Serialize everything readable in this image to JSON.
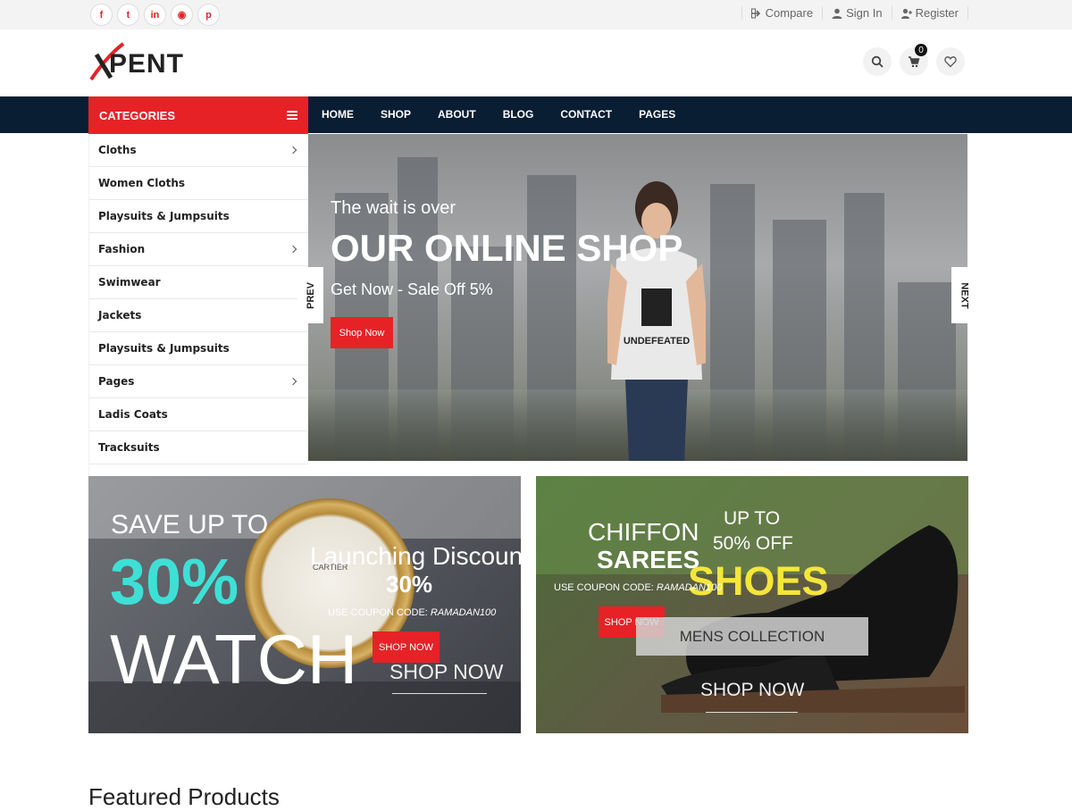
{
  "topbar": {
    "social": [
      {
        "icon": "facebook-icon",
        "glyph": "f"
      },
      {
        "icon": "twitter-icon",
        "glyph": "t"
      },
      {
        "icon": "linkedin-icon",
        "glyph": "in"
      },
      {
        "icon": "rss-icon",
        "glyph": "◉"
      },
      {
        "icon": "pinterest-icon",
        "glyph": "p"
      }
    ],
    "compare": "Compare",
    "sign_in": "Sign In",
    "register": "Register"
  },
  "header": {
    "logo_text": "PENT",
    "cart_count": "0"
  },
  "nav": {
    "categories_label": "CATEGORIES",
    "menu": [
      "HOME",
      "SHOP",
      "ABOUT",
      "BLOG",
      "CONTACT",
      "PAGES"
    ]
  },
  "categories": [
    {
      "label": "Cloths",
      "sub": true
    },
    {
      "label": "Women Cloths",
      "sub": false
    },
    {
      "label": "Playsuits & Jumpsuits",
      "sub": false
    },
    {
      "label": "Fashion",
      "sub": true
    },
    {
      "label": "Swimwear",
      "sub": false
    },
    {
      "label": "Jackets",
      "sub": false
    },
    {
      "label": "Playsuits & Jumpsuits",
      "sub": false
    },
    {
      "label": "Pages",
      "sub": true
    },
    {
      "label": "Ladis Coats",
      "sub": false
    },
    {
      "label": "Tracksuits",
      "sub": false
    }
  ],
  "hero": {
    "line1": "The wait is over",
    "line2": "OUR ONLINE SHOP",
    "line3": "Get Now - Sale Off 5%",
    "button": "Shop Now",
    "prev": "PREV",
    "next": "NEXT",
    "tshirt_text": "UNDEFEATED"
  },
  "banner_watch": {
    "save": "SAVE UP TO",
    "percent": "30%",
    "watch": "WATCH",
    "launch": "Launching Discount",
    "launch_pct": "30%",
    "coupon_prefix": "USE COUPON CODE: ",
    "coupon_code": "RAMADAN100",
    "button": "SHOP NOW",
    "shop_now": "SHOP NOW",
    "brand": "CARTIER"
  },
  "banner_shoes": {
    "chiffon": "CHIFFON",
    "sarees": "SAREES",
    "upto": "UP TO",
    "off": "50% OFF",
    "shoes": "SHOES",
    "coupon_prefix": "USE COUPON CODE: ",
    "coupon_code": "RAMADAN100",
    "button": "SHOP NOW",
    "mens": "MENS COLLECTION",
    "shop_now": "SHOP NOW"
  },
  "featured_title": "Featured Products",
  "colors": {
    "accent": "#e62227",
    "nav": "#0a1e33"
  }
}
